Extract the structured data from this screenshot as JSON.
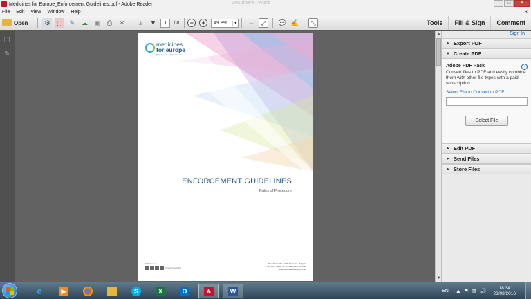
{
  "window": {
    "title": "Medicines for Europe_Enforcement Guidelines.pdf - Adobe Reader",
    "ghost_title": "Document - Word",
    "min": "–",
    "max": "□",
    "close": "✕"
  },
  "menu": [
    "File",
    "Edit",
    "View",
    "Window",
    "Help"
  ],
  "menu_close": "×",
  "toolbar": {
    "open_label": "Open",
    "page_current": "1",
    "page_total": "/ 8",
    "zoom_value": "49.8%",
    "zoom_arrow": "▾",
    "tools_label": "Tools",
    "fill_sign_label": "Fill & Sign",
    "comment_label": "Comment"
  },
  "document": {
    "logo_line1": "medicines",
    "logo_line2": "for europe",
    "logo_tagline": "Better access. Better health.",
    "title": "ENFORCEMENT GUIDELINES",
    "subtitle": "Rules of Procedure",
    "footer_follow": "Follow us at",
    "footer_handle": "@medicinesforEU",
    "footer_address_1": "Rue d'Arlon 50 - 1000 Brussels - Belgium",
    "footer_address_2": "T: +32 (0)2 736 84 11 - F: +32 (0)2 736 74 38",
    "footer_address_3": "www.medicinesforeurope.com"
  },
  "panel": {
    "sign_in": "Sign In",
    "export_pdf": "Export PDF",
    "create_pdf": "Create PDF",
    "pack_title": "Adobe PDF Pack",
    "pack_desc": "Convert files to PDF and easily combine them with other file types with a paid subscription.",
    "select_label": "Select File to Convert to PDF:",
    "select_button": "Select File",
    "edit_pdf": "Edit PDF",
    "send_files": "Send Files",
    "store_files": "Store Files",
    "collapsed_tri": "►",
    "expanded_tri": "▼"
  },
  "taskbar": {
    "apps": [
      "Internet Explorer",
      "Media Player",
      "Chrome",
      "File Explorer",
      "Skype",
      "Excel",
      "Outlook",
      "Acrobat",
      "Word"
    ],
    "language": "EN",
    "time": "18:34",
    "date": "23/03/2016"
  }
}
